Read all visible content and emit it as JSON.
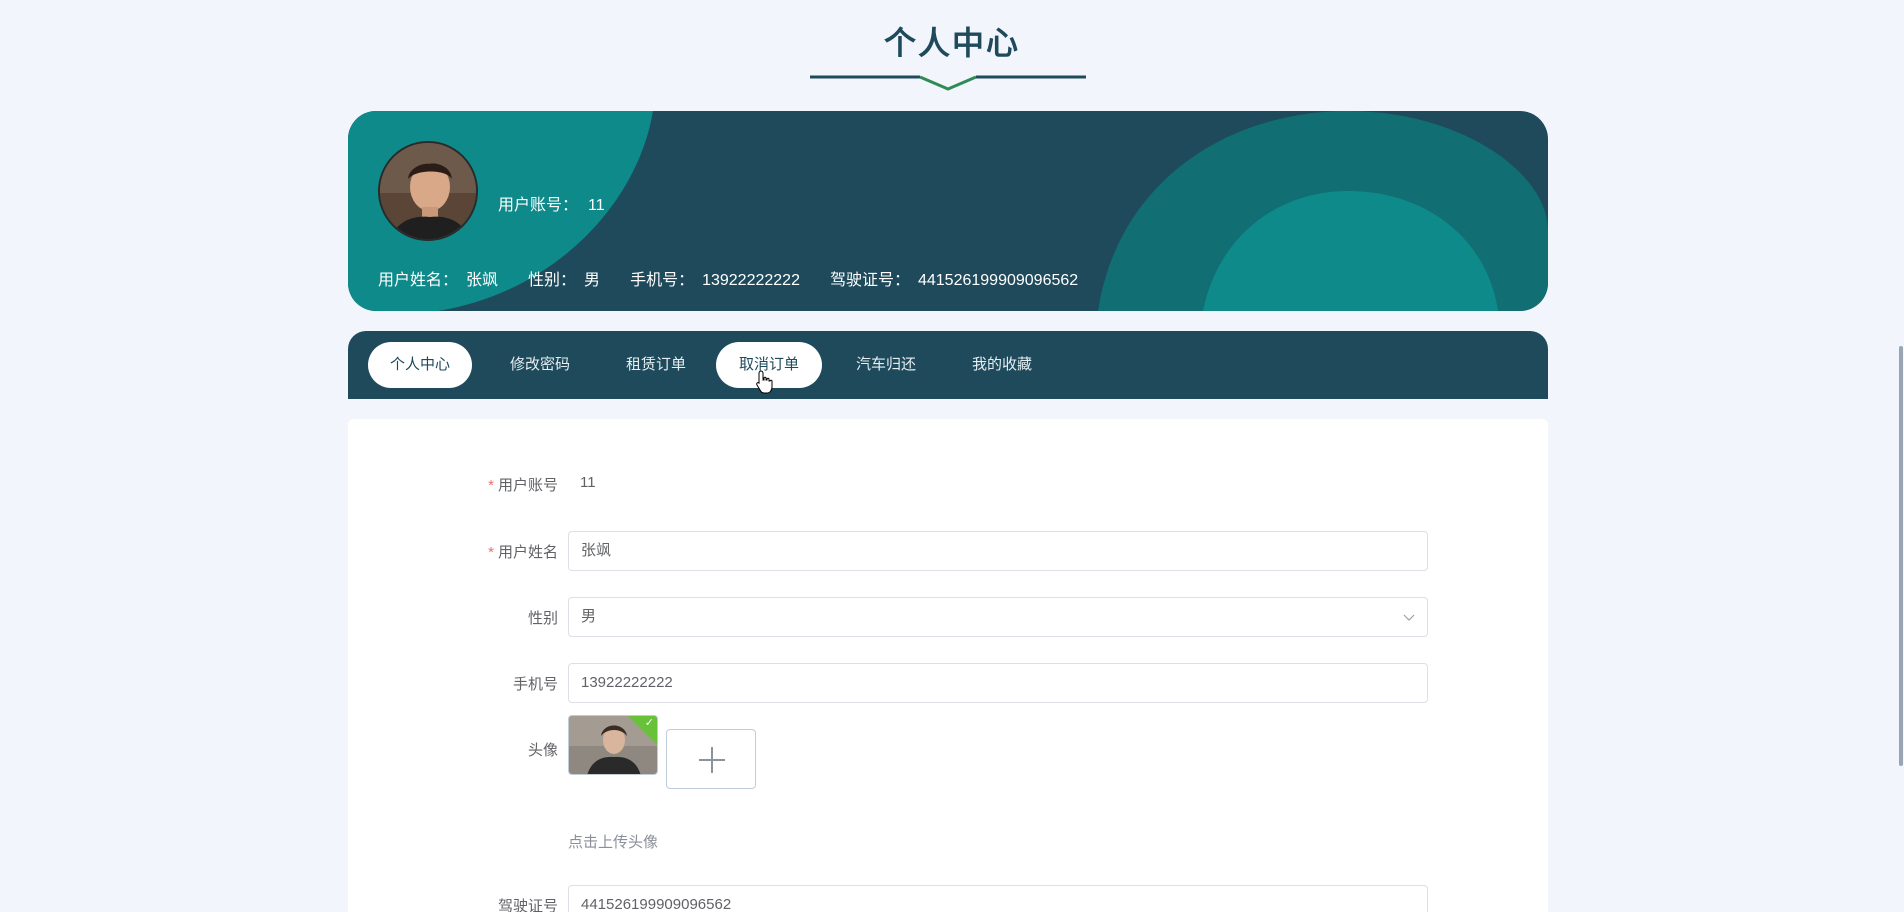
{
  "page": {
    "title": "个人中心"
  },
  "banner": {
    "account_label": "用户账号：",
    "account_value": "11",
    "name_label": "用户姓名：",
    "name_value": "张飒",
    "gender_label": "性别：",
    "gender_value": "男",
    "phone_label": "手机号：",
    "phone_value": "13922222222",
    "license_label": "驾驶证号：",
    "license_value": "441526199909096562"
  },
  "tabs": [
    {
      "label": "个人中心",
      "active": true
    },
    {
      "label": "修改密码",
      "active": false
    },
    {
      "label": "租赁订单",
      "active": false
    },
    {
      "label": "取消订单",
      "active": true
    },
    {
      "label": "汽车归还",
      "active": false
    },
    {
      "label": "我的收藏",
      "active": false
    }
  ],
  "form": {
    "account_label": "用户账号",
    "account_value": "11",
    "name_label": "用户姓名",
    "name_value": "张飒",
    "gender_label": "性别",
    "gender_value": "男",
    "phone_label": "手机号",
    "phone_value": "13922222222",
    "avatar_label": "头像",
    "upload_hint": "点击上传头像",
    "license_label": "驾驶证号",
    "license_value": "441526199909096562"
  },
  "colors": {
    "primary": "#1e4a5b",
    "accent_teal": "#0e8a8a",
    "required": "#f56c6c",
    "success": "#67c23a"
  },
  "icons": {
    "select_arrow": "chevron-down-icon",
    "upload_add": "plus-icon",
    "upload_status": "check-icon",
    "cursor": "hand-pointer-icon"
  }
}
